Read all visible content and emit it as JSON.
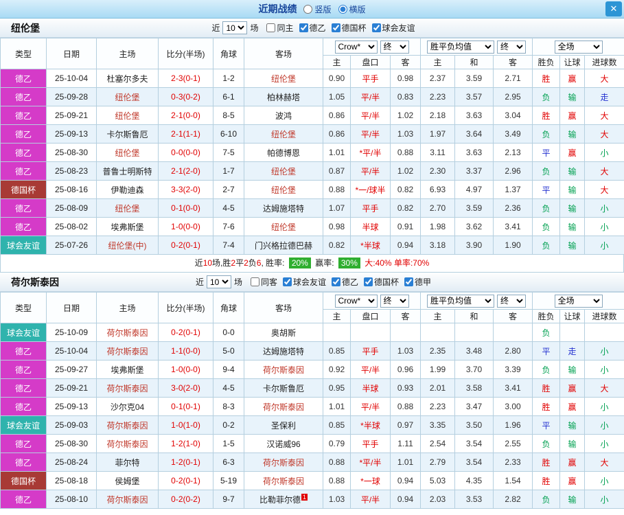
{
  "titlebar": {
    "title": "近期战绩",
    "radio_vertical": "竖版",
    "radio_horizontal": "横版",
    "close_glyph": "✕"
  },
  "sections": [
    {
      "team": "纽伦堡",
      "filter": {
        "near": "近",
        "count": "10",
        "games": "场",
        "checkboxes": [
          {
            "label": "同主",
            "checked": false
          },
          {
            "label": "德乙",
            "checked": true
          },
          {
            "label": "德国杯",
            "checked": true
          },
          {
            "label": "球会友谊",
            "checked": true
          }
        ]
      },
      "columns": {
        "type": "类型",
        "date": "日期",
        "home": "主场",
        "score": "比分(半场)",
        "corner": "角球",
        "away": "客场",
        "odds_company": "Crow*",
        "odds_final": "终",
        "avg": "胜平负均值",
        "avg_final": "终",
        "full": "全场",
        "sub": [
          "主",
          "盘口",
          "客",
          "主",
          "和",
          "客",
          "胜负",
          "让球",
          "进球数"
        ]
      },
      "rows": [
        {
          "league": "德乙",
          "league_class": "lg-de2",
          "date": "25-10-04",
          "home": "杜塞尔多夫",
          "home_focus": false,
          "score": "2-3(0-1)",
          "corner": "1-2",
          "away": "纽伦堡",
          "away_focus": true,
          "away_badge": "",
          "odds_home": "0.90",
          "handicap": "平手",
          "odds_away": "0.98",
          "avg_win": "2.37",
          "avg_draw": "3.59",
          "avg_lose": "2.71",
          "result": "胜",
          "result_class": "c-red",
          "handicap_result": "赢",
          "handicap_result_class": "c-red",
          "goals": "大",
          "goals_class": "c-red"
        },
        {
          "league": "德乙",
          "league_class": "lg-de2",
          "date": "25-09-28",
          "home": "纽伦堡",
          "home_focus": true,
          "score": "0-3(0-2)",
          "corner": "6-1",
          "away": "柏林赫塔",
          "away_focus": false,
          "away_badge": "",
          "odds_home": "1.05",
          "handicap": "平/半",
          "odds_away": "0.83",
          "avg_win": "2.23",
          "avg_draw": "3.57",
          "avg_lose": "2.95",
          "result": "负",
          "result_class": "c-green",
          "handicap_result": "输",
          "handicap_result_class": "c-green",
          "goals": "走",
          "goals_class": "c-blue"
        },
        {
          "league": "德乙",
          "league_class": "lg-de2",
          "date": "25-09-21",
          "home": "纽伦堡",
          "home_focus": true,
          "score": "2-1(0-0)",
          "corner": "8-5",
          "away": "波鸿",
          "away_focus": false,
          "away_badge": "",
          "odds_home": "0.86",
          "handicap": "平/半",
          "odds_away": "1.02",
          "avg_win": "2.18",
          "avg_draw": "3.63",
          "avg_lose": "3.04",
          "result": "胜",
          "result_class": "c-red",
          "handicap_result": "赢",
          "handicap_result_class": "c-red",
          "goals": "大",
          "goals_class": "c-red"
        },
        {
          "league": "德乙",
          "league_class": "lg-de2",
          "date": "25-09-13",
          "home": "卡尔斯鲁厄",
          "home_focus": false,
          "score": "2-1(1-1)",
          "corner": "6-10",
          "away": "纽伦堡",
          "away_focus": true,
          "away_badge": "",
          "odds_home": "0.86",
          "handicap": "平/半",
          "odds_away": "1.03",
          "avg_win": "1.97",
          "avg_draw": "3.64",
          "avg_lose": "3.49",
          "result": "负",
          "result_class": "c-green",
          "handicap_result": "输",
          "handicap_result_class": "c-green",
          "goals": "大",
          "goals_class": "c-red"
        },
        {
          "league": "德乙",
          "league_class": "lg-de2",
          "date": "25-08-30",
          "home": "纽伦堡",
          "home_focus": true,
          "score": "0-0(0-0)",
          "corner": "7-5",
          "away": "帕德博恩",
          "away_focus": false,
          "away_badge": "",
          "odds_home": "1.01",
          "handicap": "*平/半",
          "odds_away": "0.88",
          "avg_win": "3.11",
          "avg_draw": "3.63",
          "avg_lose": "2.13",
          "result": "平",
          "result_class": "c-blue",
          "handicap_result": "赢",
          "handicap_result_class": "c-red",
          "goals": "小",
          "goals_class": "c-green"
        },
        {
          "league": "德乙",
          "league_class": "lg-de2",
          "date": "25-08-23",
          "home": "普鲁士明斯特",
          "home_focus": false,
          "score": "2-1(2-0)",
          "corner": "1-7",
          "away": "纽伦堡",
          "away_focus": true,
          "away_badge": "",
          "odds_home": "0.87",
          "handicap": "平/半",
          "odds_away": "1.02",
          "avg_win": "2.30",
          "avg_draw": "3.37",
          "avg_lose": "2.96",
          "result": "负",
          "result_class": "c-green",
          "handicap_result": "输",
          "handicap_result_class": "c-green",
          "goals": "大",
          "goals_class": "c-red"
        },
        {
          "league": "德国杯",
          "league_class": "lg-cup",
          "date": "25-08-16",
          "home": "伊勒迪森",
          "home_focus": false,
          "score": "3-3(2-0)",
          "corner": "2-7",
          "away": "纽伦堡",
          "away_focus": true,
          "away_badge": "",
          "odds_home": "0.88",
          "handicap": "*一/球半",
          "odds_away": "0.82",
          "avg_win": "6.93",
          "avg_draw": "4.97",
          "avg_lose": "1.37",
          "result": "平",
          "result_class": "c-blue",
          "handicap_result": "输",
          "handicap_result_class": "c-green",
          "goals": "大",
          "goals_class": "c-red"
        },
        {
          "league": "德乙",
          "league_class": "lg-de2",
          "date": "25-08-09",
          "home": "纽伦堡",
          "home_focus": true,
          "score": "0-1(0-0)",
          "corner": "4-5",
          "away": "达姆施塔特",
          "away_focus": false,
          "away_badge": "",
          "odds_home": "1.07",
          "handicap": "平手",
          "odds_away": "0.82",
          "avg_win": "2.70",
          "avg_draw": "3.59",
          "avg_lose": "2.36",
          "result": "负",
          "result_class": "c-green",
          "handicap_result": "输",
          "handicap_result_class": "c-green",
          "goals": "小",
          "goals_class": "c-green"
        },
        {
          "league": "德乙",
          "league_class": "lg-de2",
          "date": "25-08-02",
          "home": "埃弗斯堡",
          "home_focus": false,
          "score": "1-0(0-0)",
          "corner": "7-6",
          "away": "纽伦堡",
          "away_focus": true,
          "away_badge": "",
          "odds_home": "0.98",
          "handicap": "半球",
          "odds_away": "0.91",
          "avg_win": "1.98",
          "avg_draw": "3.62",
          "avg_lose": "3.41",
          "result": "负",
          "result_class": "c-green",
          "handicap_result": "输",
          "handicap_result_class": "c-green",
          "goals": "小",
          "goals_class": "c-green"
        },
        {
          "league": "球会友谊",
          "league_class": "lg-friendly",
          "date": "25-07-26",
          "home": "纽伦堡(中)",
          "home_focus": true,
          "score": "0-2(0-1)",
          "corner": "7-4",
          "away": "门兴格拉德巴赫",
          "away_focus": false,
          "away_badge": "",
          "odds_home": "0.82",
          "handicap": "*半球",
          "odds_away": "0.94",
          "avg_win": "3.18",
          "avg_draw": "3.90",
          "avg_lose": "1.90",
          "result": "负",
          "result_class": "c-green",
          "handicap_result": "输",
          "handicap_result_class": "c-green",
          "goals": "小",
          "goals_class": "c-green"
        }
      ],
      "summary": [
        {
          "t": "近"
        },
        {
          "t": "10",
          "c": "red"
        },
        {
          "t": "场,胜"
        },
        {
          "t": "2",
          "c": "red"
        },
        {
          "t": "平"
        },
        {
          "t": "2",
          "c": "red"
        },
        {
          "t": "负"
        },
        {
          "t": "6",
          "c": "red"
        },
        {
          "t": ", 胜率: "
        },
        {
          "t": "20%",
          "c": "badge"
        },
        {
          "t": " 赢率: "
        },
        {
          "t": "30%",
          "c": "badge"
        },
        {
          "t": " 大:",
          "c": "red"
        },
        {
          "t": "40%",
          "c": "red"
        },
        {
          "t": " 单率:",
          "c": "red"
        },
        {
          "t": "70%",
          "c": "red"
        }
      ]
    },
    {
      "team": "荷尔斯泰因",
      "filter": {
        "near": "近",
        "count": "10",
        "games": "场",
        "checkboxes": [
          {
            "label": "同客",
            "checked": false
          },
          {
            "label": "球会友谊",
            "checked": true
          },
          {
            "label": "德乙",
            "checked": true
          },
          {
            "label": "德国杯",
            "checked": true
          },
          {
            "label": "德甲",
            "checked": true
          }
        ]
      },
      "columns": {
        "type": "类型",
        "date": "日期",
        "home": "主场",
        "score": "比分(半场)",
        "corner": "角球",
        "away": "客场",
        "odds_company": "Crow*",
        "odds_final": "终",
        "avg": "胜平负均值",
        "avg_final": "终",
        "full": "全场",
        "sub": [
          "主",
          "盘口",
          "客",
          "主",
          "和",
          "客",
          "胜负",
          "让球",
          "进球数"
        ]
      },
      "rows": [
        {
          "league": "球会友谊",
          "league_class": "lg-friendly",
          "date": "25-10-09",
          "home": "荷尔斯泰因",
          "home_focus": true,
          "score": "0-2(0-1)",
          "corner": "0-0",
          "away": "奥胡斯",
          "away_focus": false,
          "away_badge": "",
          "odds_home": "",
          "handicap": "",
          "odds_away": "",
          "avg_win": "",
          "avg_draw": "",
          "avg_lose": "",
          "result": "负",
          "result_class": "c-green",
          "handicap_result": "",
          "handicap_result_class": "",
          "goals": "",
          "goals_class": ""
        },
        {
          "league": "德乙",
          "league_class": "lg-de2",
          "date": "25-10-04",
          "home": "荷尔斯泰因",
          "home_focus": true,
          "score": "1-1(0-0)",
          "corner": "5-0",
          "away": "达姆施塔特",
          "away_focus": false,
          "away_badge": "",
          "odds_home": "0.85",
          "handicap": "平手",
          "odds_away": "1.03",
          "avg_win": "2.35",
          "avg_draw": "3.48",
          "avg_lose": "2.80",
          "result": "平",
          "result_class": "c-blue",
          "handicap_result": "走",
          "handicap_result_class": "c-blue",
          "goals": "小",
          "goals_class": "c-green"
        },
        {
          "league": "德乙",
          "league_class": "lg-de2",
          "date": "25-09-27",
          "home": "埃弗斯堡",
          "home_focus": false,
          "score": "1-0(0-0)",
          "corner": "9-4",
          "away": "荷尔斯泰因",
          "away_focus": true,
          "away_badge": "",
          "odds_home": "0.92",
          "handicap": "平/半",
          "odds_away": "0.96",
          "avg_win": "1.99",
          "avg_draw": "3.70",
          "avg_lose": "3.39",
          "result": "负",
          "result_class": "c-green",
          "handicap_result": "输",
          "handicap_result_class": "c-green",
          "goals": "小",
          "goals_class": "c-green"
        },
        {
          "league": "德乙",
          "league_class": "lg-de2",
          "date": "25-09-21",
          "home": "荷尔斯泰因",
          "home_focus": true,
          "score": "3-0(2-0)",
          "corner": "4-5",
          "away": "卡尔斯鲁厄",
          "away_focus": false,
          "away_badge": "",
          "odds_home": "0.95",
          "handicap": "半球",
          "odds_away": "0.93",
          "avg_win": "2.01",
          "avg_draw": "3.58",
          "avg_lose": "3.41",
          "result": "胜",
          "result_class": "c-red",
          "handicap_result": "赢",
          "handicap_result_class": "c-red",
          "goals": "大",
          "goals_class": "c-red"
        },
        {
          "league": "德乙",
          "league_class": "lg-de2",
          "date": "25-09-13",
          "home": "沙尔克04",
          "home_focus": false,
          "score": "0-1(0-1)",
          "corner": "8-3",
          "away": "荷尔斯泰因",
          "away_focus": true,
          "away_badge": "",
          "odds_home": "1.01",
          "handicap": "平/半",
          "odds_away": "0.88",
          "avg_win": "2.23",
          "avg_draw": "3.47",
          "avg_lose": "3.00",
          "result": "胜",
          "result_class": "c-red",
          "handicap_result": "赢",
          "handicap_result_class": "c-red",
          "goals": "小",
          "goals_class": "c-green"
        },
        {
          "league": "球会友谊",
          "league_class": "lg-friendly",
          "date": "25-09-03",
          "home": "荷尔斯泰因",
          "home_focus": true,
          "score": "1-0(1-0)",
          "corner": "0-2",
          "away": "圣保利",
          "away_focus": false,
          "away_badge": "",
          "odds_home": "0.85",
          "handicap": "*半球",
          "odds_away": "0.97",
          "avg_win": "3.35",
          "avg_draw": "3.50",
          "avg_lose": "1.96",
          "result": "平",
          "result_class": "c-blue",
          "handicap_result": "输",
          "handicap_result_class": "c-green",
          "goals": "小",
          "goals_class": "c-green"
        },
        {
          "league": "德乙",
          "league_class": "lg-de2",
          "date": "25-08-30",
          "home": "荷尔斯泰因",
          "home_focus": true,
          "score": "1-2(1-0)",
          "corner": "1-5",
          "away": "汉诺威96",
          "away_focus": false,
          "away_badge": "",
          "odds_home": "0.79",
          "handicap": "平手",
          "odds_away": "1.11",
          "avg_win": "2.54",
          "avg_draw": "3.54",
          "avg_lose": "2.55",
          "result": "负",
          "result_class": "c-green",
          "handicap_result": "输",
          "handicap_result_class": "c-green",
          "goals": "小",
          "goals_class": "c-green"
        },
        {
          "league": "德乙",
          "league_class": "lg-de2",
          "date": "25-08-24",
          "home": "菲尔特",
          "home_focus": false,
          "score": "1-2(0-1)",
          "corner": "6-3",
          "away": "荷尔斯泰因",
          "away_focus": true,
          "away_badge": "",
          "odds_home": "0.88",
          "handicap": "*平/半",
          "odds_away": "1.01",
          "avg_win": "2.79",
          "avg_draw": "3.54",
          "avg_lose": "2.33",
          "result": "胜",
          "result_class": "c-red",
          "handicap_result": "赢",
          "handicap_result_class": "c-red",
          "goals": "大",
          "goals_class": "c-red"
        },
        {
          "league": "德国杯",
          "league_class": "lg-cup",
          "date": "25-08-18",
          "home": "侯姆堡",
          "home_focus": false,
          "score": "0-2(0-1)",
          "corner": "5-19",
          "away": "荷尔斯泰因",
          "away_focus": true,
          "away_badge": "",
          "odds_home": "0.88",
          "handicap": "*一球",
          "odds_away": "0.94",
          "avg_win": "5.03",
          "avg_draw": "4.35",
          "avg_lose": "1.54",
          "result": "胜",
          "result_class": "c-red",
          "handicap_result": "赢",
          "handicap_result_class": "c-red",
          "goals": "小",
          "goals_class": "c-green"
        },
        {
          "league": "德乙",
          "league_class": "lg-de2",
          "date": "25-08-10",
          "home": "荷尔斯泰因",
          "home_focus": true,
          "score": "0-2(0-2)",
          "corner": "9-7",
          "away": "比勒菲尔德",
          "away_focus": false,
          "away_badge": "1",
          "odds_home": "1.03",
          "handicap": "平/半",
          "odds_away": "0.94",
          "avg_win": "2.03",
          "avg_draw": "3.53",
          "avg_lose": "2.82",
          "result": "负",
          "result_class": "c-green",
          "handicap_result": "输",
          "handicap_result_class": "c-green",
          "goals": "小",
          "goals_class": "c-green"
        }
      ],
      "summary": null
    }
  ]
}
